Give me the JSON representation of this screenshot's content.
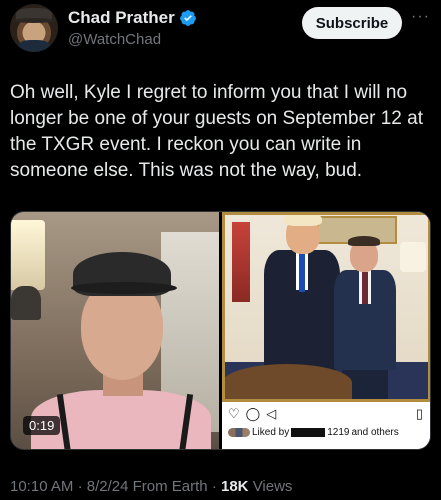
{
  "author": {
    "display_name": "Chad Prather",
    "handle": "@WatchChad",
    "avatar_icon": "avatar-cowboy-hat"
  },
  "actions": {
    "subscribe_label": "Subscribe",
    "more_label": "···"
  },
  "tweet": {
    "text": "Oh well, Kyle I regret to inform you that I will no longer be one of your guests on September 12 at the TXGR event. I reckon you can write in someone else. This was not the way, bud."
  },
  "media": {
    "video_duration": "0:19",
    "instagram": {
      "liked_prefix": "Liked by",
      "liked_count": "1219",
      "liked_suffix": "and others",
      "icons": [
        "heart-icon",
        "comment-icon",
        "share-icon",
        "bookmark-icon"
      ]
    }
  },
  "meta": {
    "time": "10:10 AM",
    "separator": "·",
    "date": "8/2/24",
    "source": "From Earth",
    "views_count": "18K",
    "views_label": "Views"
  },
  "colors": {
    "background": "#000000",
    "text": "#e7e9ea",
    "muted": "#71767b",
    "verified": "#1d9bf0"
  }
}
